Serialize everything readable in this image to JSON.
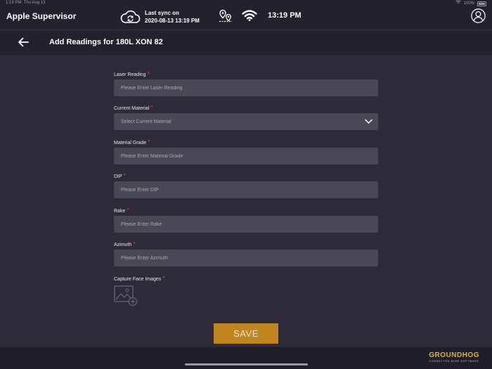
{
  "status_bar": {
    "time": "1:19 PM",
    "date": "Thu Aug 13",
    "battery": "100%"
  },
  "header": {
    "app_name": "Apple Supervisor",
    "sync_title": "Last sync on",
    "sync_datetime": "2020-08-13 13:19 PM",
    "clock": "13:19 PM",
    "icons": {
      "sync": "cloud-sync-icon",
      "location": "map-pins-icon",
      "wifi": "wifi-icon",
      "user": "user-profile-icon"
    }
  },
  "nav": {
    "back_icon": "arrow-left-icon",
    "title": "Add Readings for 180L XON 82"
  },
  "form": {
    "required_mark": "*",
    "laser_reading": {
      "label": "Laser Reading",
      "placeholder": "Please Enter Laser Reading"
    },
    "current_material": {
      "label": "Current Material",
      "selected": "Select Current Material"
    },
    "material_grade": {
      "label": "Material Grade",
      "placeholder": "Please Enter Material Grade"
    },
    "dip": {
      "label": "DIP",
      "placeholder": "Please Enter DIP"
    },
    "rake": {
      "label": "Rake",
      "placeholder": "Please Enter Rake"
    },
    "azimuth": {
      "label": "Azimuth",
      "placeholder": "Please Enter Azimuth"
    },
    "capture": {
      "label": "Capture Face Images",
      "icon": "add-image-icon"
    },
    "save_label": "SAVE"
  },
  "footer": {
    "brand_name": "GROUNDHOG",
    "brand_tagline": "CONNECTED MINE SOFTWARE"
  },
  "colors": {
    "background": "#2d2b3a",
    "bar": "#22212d",
    "input": "#4a4856",
    "accent": "#c1851f",
    "required": "#e53935",
    "brand": "#e8b21c"
  }
}
